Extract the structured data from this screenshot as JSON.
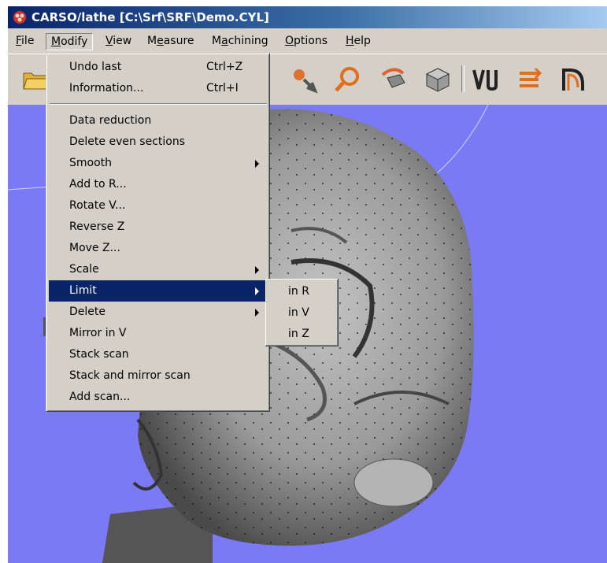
{
  "window": {
    "title": "CARSO/lathe  [C:\\Srf\\SRF\\Demo.CYL]"
  },
  "menubar": {
    "items": [
      {
        "label": "File",
        "access": "F"
      },
      {
        "label": "Modify",
        "access": "M"
      },
      {
        "label": "View",
        "access": "V"
      },
      {
        "label": "Measure",
        "access": "e"
      },
      {
        "label": "Machining",
        "access": "a"
      },
      {
        "label": "Options",
        "access": "O"
      },
      {
        "label": "Help",
        "access": "H"
      }
    ],
    "active": "Modify"
  },
  "toolbar": {
    "icons": [
      "open-folder-icon",
      "rotate-view-icon",
      "zoom-icon",
      "undo-rotate-icon",
      "cube-icon",
      "tool-vu-icon",
      "arrows-swap-icon",
      "profile-curve-icon"
    ]
  },
  "menu": {
    "items": [
      {
        "label": "Undo last",
        "shortcut": "Ctrl+Z"
      },
      {
        "label": "Information...",
        "shortcut": "Ctrl+I"
      },
      {
        "label": "Data reduction"
      },
      {
        "label": "Delete even sections"
      },
      {
        "label": "Smooth",
        "submenu": true
      },
      {
        "label": "Add to R..."
      },
      {
        "label": "Rotate V..."
      },
      {
        "label": "Reverse Z"
      },
      {
        "label": "Move Z..."
      },
      {
        "label": "Scale",
        "submenu": true
      },
      {
        "label": "Limit",
        "submenu": true,
        "highlighted": true
      },
      {
        "label": "Delete",
        "submenu": true
      },
      {
        "label": "Mirror in V"
      },
      {
        "label": "Stack scan"
      },
      {
        "label": "Stack and mirror scan"
      },
      {
        "label": "Add scan..."
      }
    ]
  },
  "submenu": {
    "items": [
      {
        "label": "in R"
      },
      {
        "label": "in V"
      },
      {
        "label": "in Z"
      }
    ]
  },
  "colors": {
    "viewport_bg": "#7a7af6",
    "menu_bg": "#d4d0c8",
    "highlight": "#0a246a"
  }
}
